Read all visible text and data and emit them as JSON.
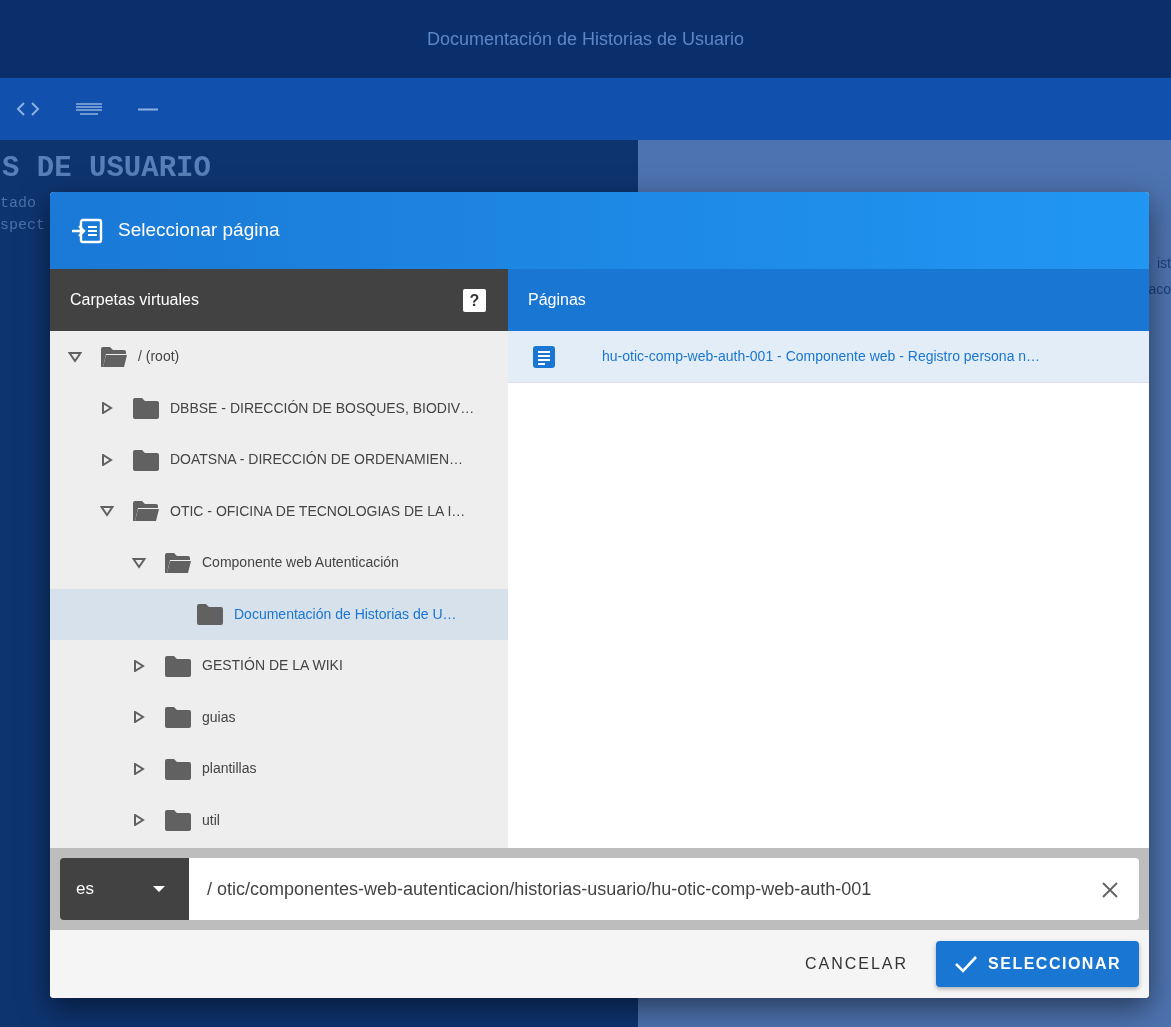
{
  "app": {
    "title": "Documentación de Historias de Usuario",
    "left_heading": "S DE USUARIO",
    "left_lines": [
      "tado",
      "spect"
    ],
    "right_lines": [
      "ist",
      "aco"
    ]
  },
  "dialog": {
    "title": "Seleccionar página",
    "folders_header": "Carpetas virtuales",
    "help": "?",
    "pages_header": "Páginas",
    "tree": [
      {
        "label": "/ (root)",
        "expanded": true,
        "selected": false,
        "children": [
          {
            "label": "DBBSE - DIRECCIÓN DE BOSQUES, BIODIV…",
            "expanded": false,
            "selected": false
          },
          {
            "label": "DOATSNA - DIRECCIÓN DE ORDENAMIEN…",
            "expanded": false,
            "selected": false
          },
          {
            "label": "OTIC - OFICINA DE TECNOLOGIAS DE LA I…",
            "expanded": true,
            "selected": false,
            "children": [
              {
                "label": "Componente web Autenticación",
                "expanded": true,
                "selected": false,
                "children": [
                  {
                    "label": "Documentación de Historias de U…",
                    "selected": true
                  }
                ]
              },
              {
                "label": "GESTIÓN DE LA WIKI",
                "expanded": false,
                "selected": false
              },
              {
                "label": "guias",
                "expanded": false,
                "selected": false
              },
              {
                "label": "plantillas",
                "expanded": false,
                "selected": false
              },
              {
                "label": "util",
                "expanded": false,
                "selected": false
              }
            ]
          }
        ]
      }
    ],
    "pages": [
      {
        "label": "hu-otic-comp-web-auth-001 - Componente web - Registro persona n…",
        "selected": true
      }
    ],
    "locale": "es",
    "path": "/ otic/componentes-web-autenticacion/historias-usuario/hu-otic-comp-web-auth-001",
    "buttons": [
      {
        "label": "CANCELAR",
        "kind": "text"
      },
      {
        "label": "SELECCIONAR",
        "kind": "primary"
      }
    ]
  }
}
